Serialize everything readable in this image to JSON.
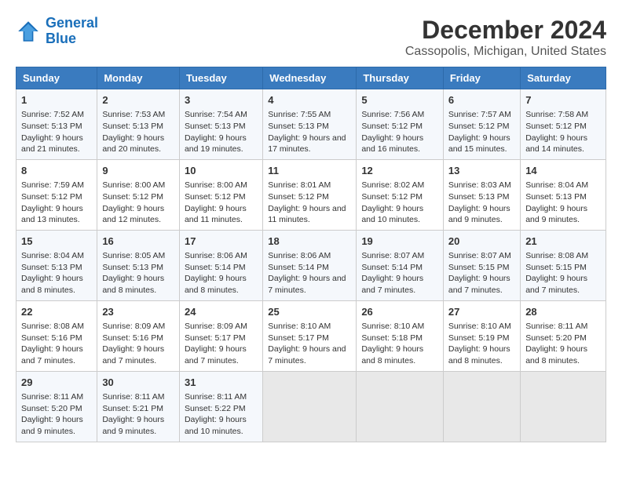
{
  "logo": {
    "text_general": "General",
    "text_blue": "Blue"
  },
  "title": "December 2024",
  "subtitle": "Cassopolis, Michigan, United States",
  "days_of_week": [
    "Sunday",
    "Monday",
    "Tuesday",
    "Wednesday",
    "Thursday",
    "Friday",
    "Saturday"
  ],
  "weeks": [
    [
      {
        "day": "1",
        "sunrise": "7:52 AM",
        "sunset": "5:13 PM",
        "daylight": "9 hours and 21 minutes."
      },
      {
        "day": "2",
        "sunrise": "7:53 AM",
        "sunset": "5:13 PM",
        "daylight": "9 hours and 20 minutes."
      },
      {
        "day": "3",
        "sunrise": "7:54 AM",
        "sunset": "5:13 PM",
        "daylight": "9 hours and 19 minutes."
      },
      {
        "day": "4",
        "sunrise": "7:55 AM",
        "sunset": "5:13 PM",
        "daylight": "9 hours and 17 minutes."
      },
      {
        "day": "5",
        "sunrise": "7:56 AM",
        "sunset": "5:12 PM",
        "daylight": "9 hours and 16 minutes."
      },
      {
        "day": "6",
        "sunrise": "7:57 AM",
        "sunset": "5:12 PM",
        "daylight": "9 hours and 15 minutes."
      },
      {
        "day": "7",
        "sunrise": "7:58 AM",
        "sunset": "5:12 PM",
        "daylight": "9 hours and 14 minutes."
      }
    ],
    [
      {
        "day": "8",
        "sunrise": "7:59 AM",
        "sunset": "5:12 PM",
        "daylight": "9 hours and 13 minutes."
      },
      {
        "day": "9",
        "sunrise": "8:00 AM",
        "sunset": "5:12 PM",
        "daylight": "9 hours and 12 minutes."
      },
      {
        "day": "10",
        "sunrise": "8:00 AM",
        "sunset": "5:12 PM",
        "daylight": "9 hours and 11 minutes."
      },
      {
        "day": "11",
        "sunrise": "8:01 AM",
        "sunset": "5:12 PM",
        "daylight": "9 hours and 11 minutes."
      },
      {
        "day": "12",
        "sunrise": "8:02 AM",
        "sunset": "5:12 PM",
        "daylight": "9 hours and 10 minutes."
      },
      {
        "day": "13",
        "sunrise": "8:03 AM",
        "sunset": "5:13 PM",
        "daylight": "9 hours and 9 minutes."
      },
      {
        "day": "14",
        "sunrise": "8:04 AM",
        "sunset": "5:13 PM",
        "daylight": "9 hours and 9 minutes."
      }
    ],
    [
      {
        "day": "15",
        "sunrise": "8:04 AM",
        "sunset": "5:13 PM",
        "daylight": "9 hours and 8 minutes."
      },
      {
        "day": "16",
        "sunrise": "8:05 AM",
        "sunset": "5:13 PM",
        "daylight": "9 hours and 8 minutes."
      },
      {
        "day": "17",
        "sunrise": "8:06 AM",
        "sunset": "5:14 PM",
        "daylight": "9 hours and 8 minutes."
      },
      {
        "day": "18",
        "sunrise": "8:06 AM",
        "sunset": "5:14 PM",
        "daylight": "9 hours and 7 minutes."
      },
      {
        "day": "19",
        "sunrise": "8:07 AM",
        "sunset": "5:14 PM",
        "daylight": "9 hours and 7 minutes."
      },
      {
        "day": "20",
        "sunrise": "8:07 AM",
        "sunset": "5:15 PM",
        "daylight": "9 hours and 7 minutes."
      },
      {
        "day": "21",
        "sunrise": "8:08 AM",
        "sunset": "5:15 PM",
        "daylight": "9 hours and 7 minutes."
      }
    ],
    [
      {
        "day": "22",
        "sunrise": "8:08 AM",
        "sunset": "5:16 PM",
        "daylight": "9 hours and 7 minutes."
      },
      {
        "day": "23",
        "sunrise": "8:09 AM",
        "sunset": "5:16 PM",
        "daylight": "9 hours and 7 minutes."
      },
      {
        "day": "24",
        "sunrise": "8:09 AM",
        "sunset": "5:17 PM",
        "daylight": "9 hours and 7 minutes."
      },
      {
        "day": "25",
        "sunrise": "8:10 AM",
        "sunset": "5:17 PM",
        "daylight": "9 hours and 7 minutes."
      },
      {
        "day": "26",
        "sunrise": "8:10 AM",
        "sunset": "5:18 PM",
        "daylight": "9 hours and 8 minutes."
      },
      {
        "day": "27",
        "sunrise": "8:10 AM",
        "sunset": "5:19 PM",
        "daylight": "9 hours and 8 minutes."
      },
      {
        "day": "28",
        "sunrise": "8:11 AM",
        "sunset": "5:20 PM",
        "daylight": "9 hours and 8 minutes."
      }
    ],
    [
      {
        "day": "29",
        "sunrise": "8:11 AM",
        "sunset": "5:20 PM",
        "daylight": "9 hours and 9 minutes."
      },
      {
        "day": "30",
        "sunrise": "8:11 AM",
        "sunset": "5:21 PM",
        "daylight": "9 hours and 9 minutes."
      },
      {
        "day": "31",
        "sunrise": "8:11 AM",
        "sunset": "5:22 PM",
        "daylight": "9 hours and 10 minutes."
      },
      null,
      null,
      null,
      null
    ]
  ]
}
